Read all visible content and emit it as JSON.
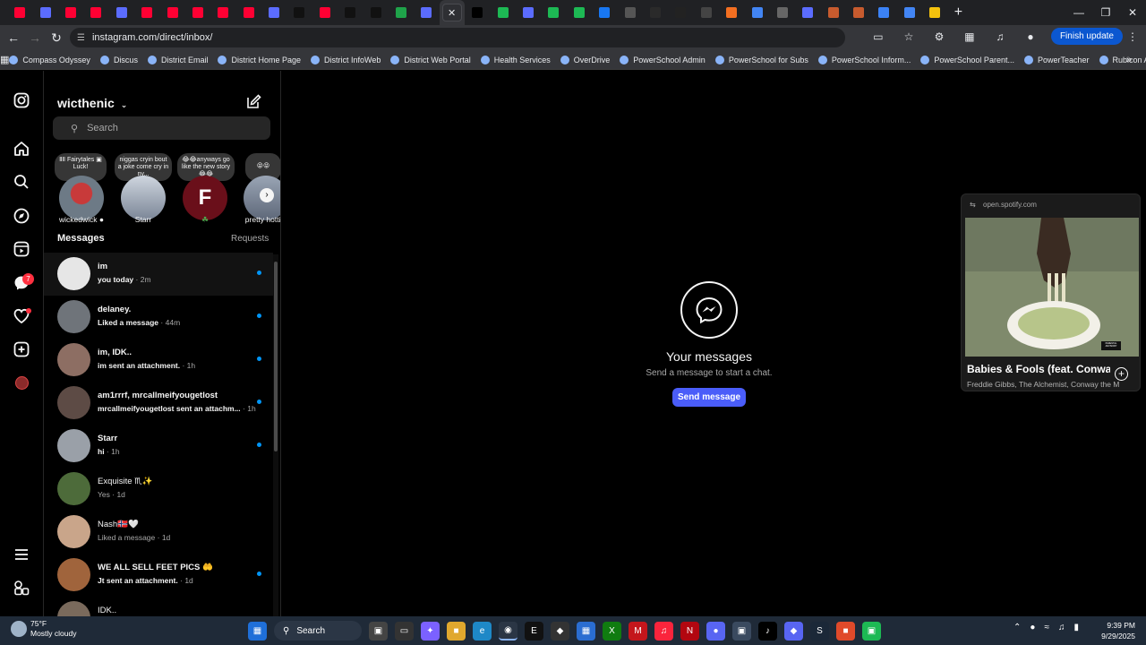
{
  "browser": {
    "tabs": [
      "youtube",
      "panel",
      "youtube",
      "youtube",
      "panel",
      "youtube",
      "youtube",
      "youtube",
      "youtube",
      "youtube",
      "panel",
      "tiktok",
      "youtube",
      "tiktok",
      "tiktok",
      "k",
      "panel",
      "active",
      "x",
      "green",
      "panel",
      "spotify",
      "spotify",
      "facebook",
      "check",
      "dark",
      "t",
      "diamond",
      "orange",
      "google",
      "puzzle",
      "panel",
      "circle",
      "circle",
      "globe",
      "google",
      "yellow"
    ],
    "new_tab_label": "+",
    "url": "instagram.com/direct/inbox/",
    "finish_update_label": "Finish update",
    "bookmarks": [
      "Compass Odyssey",
      "Discus",
      "District Email",
      "District Home Page",
      "District InfoWeb",
      "District Web Portal",
      "Health Services",
      "OverDrive",
      "PowerSchool Admin",
      "PowerSchool for Subs",
      "PowerSchool Inform...",
      "PowerSchool Parent...",
      "PowerTeacher",
      "Rubicon Atlas"
    ]
  },
  "instagram": {
    "username": "wicthenic",
    "search_placeholder": "Search",
    "notifications_badge": "7",
    "notes": [
      {
        "text": "ⅡⅡ Fairytales ▣ Luck!"
      },
      {
        "text": "niggas cryin bout a joke come cry in ny..."
      },
      {
        "text": "😂😂anyways go like the new story 😂😂"
      },
      {
        "text": "😝😝"
      }
    ],
    "stories": [
      {
        "label": "wickedwick ●"
      },
      {
        "label": "Starr"
      },
      {
        "label": "☘",
        "initial": "F"
      },
      {
        "label": "pretty hottie"
      }
    ],
    "messages_header": "Messages",
    "requests_label": "Requests",
    "conversations": [
      {
        "name": "im",
        "preview": "you today",
        "time": "2m",
        "unread": true
      },
      {
        "name": "delaney.",
        "preview": "Liked a message",
        "time": "44m",
        "unread": true
      },
      {
        "name": "im, IDK..",
        "preview": "im sent an attachment.",
        "time": "1h",
        "unread": true
      },
      {
        "name": "am1rrrf, mrcallmeifyougetlost",
        "preview": "mrcallmeifyougetlost sent an attachm...",
        "time": "1h",
        "unread": true
      },
      {
        "name": "Starr",
        "preview": "hi",
        "time": "1h",
        "unread": true
      },
      {
        "name": "Exquisite ♏✨",
        "preview": "Yes",
        "time": "1d",
        "unread": false
      },
      {
        "name": "Nash🇳🇴🤍",
        "preview": "Liked a message",
        "time": "1d",
        "unread": false
      },
      {
        "name": "WE ALL SELL FEET PICS 🤲",
        "preview": "Jt sent an attachment.",
        "time": "1d",
        "unread": true
      },
      {
        "name": "IDK..",
        "preview": "",
        "time": "",
        "unread": false
      }
    ],
    "empty_state": {
      "title": "Your messages",
      "subtitle": "Send a message to start a chat.",
      "button": "Send message"
    }
  },
  "spotify_mini": {
    "domain": "open.spotify.com",
    "song": "Babies & Fools (feat. Conway the Machine)",
    "artist": "Freddie Gibbs, The Alchemist, Conway the Machine",
    "explicit_tag": "PARENTAL ADVISORY"
  },
  "taskbar": {
    "temperature": "75°F",
    "weather": "Mostly cloudy",
    "search_label": "Search",
    "time": "9:39 PM",
    "date": "9/29/2025"
  },
  "colors": {
    "accent": "#0095f6",
    "send_button": "#4a5df9",
    "badge": "#ff3040"
  }
}
